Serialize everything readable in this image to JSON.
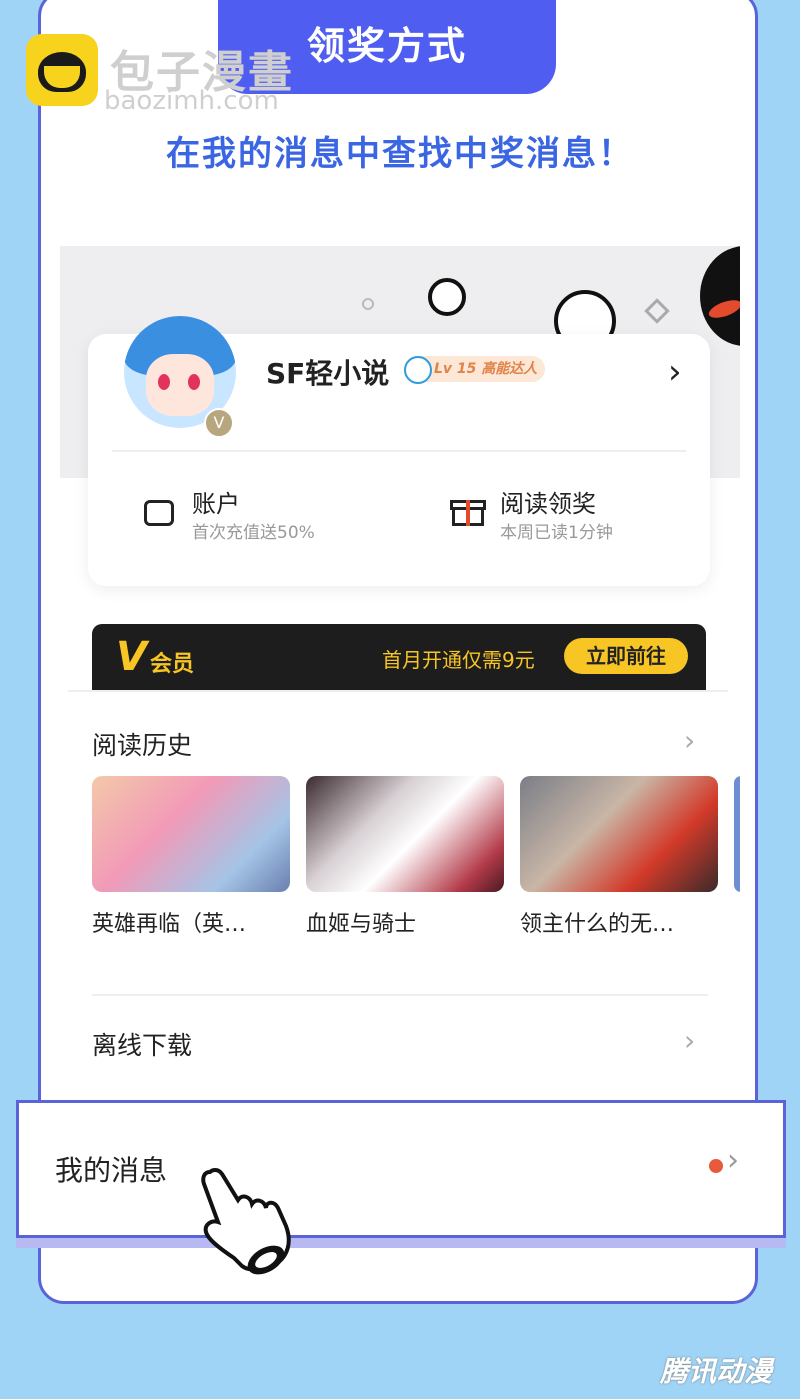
{
  "header": {
    "title": "领奖方式"
  },
  "brand": {
    "name": "包子漫畫",
    "url": "baozimh.com"
  },
  "subtitle": "在我的消息中查找中奖消息！",
  "profile": {
    "name": "SF轻小说",
    "level_badge": "Lv 15 高能达人",
    "verified_badge": "V",
    "actions": [
      {
        "title": "账户",
        "subtitle": "首次充值送50%",
        "icon": "wallet-icon"
      },
      {
        "title": "阅读领奖",
        "subtitle": "本周已读1分钟",
        "icon": "gift-icon"
      }
    ]
  },
  "vip": {
    "logo": "V",
    "label": "会员",
    "promo": "首月开通仅需9元",
    "button": "立即前往"
  },
  "reading_history": {
    "title": "阅读历史",
    "items": [
      {
        "title": "英雄再临（英…"
      },
      {
        "title": "血姬与骑士"
      },
      {
        "title": "领主什么的无…"
      }
    ]
  },
  "offline_download": {
    "title": "离线下载"
  },
  "my_messages": {
    "title": "我的消息",
    "has_unread": true
  },
  "watermark": "腾讯动漫",
  "colors": {
    "accent": "#4f5ef0",
    "subtitle": "#3b66e3",
    "vip_gold": "#f7c524",
    "unread_dot": "#e85a3c",
    "background": "#9fd4f7"
  }
}
